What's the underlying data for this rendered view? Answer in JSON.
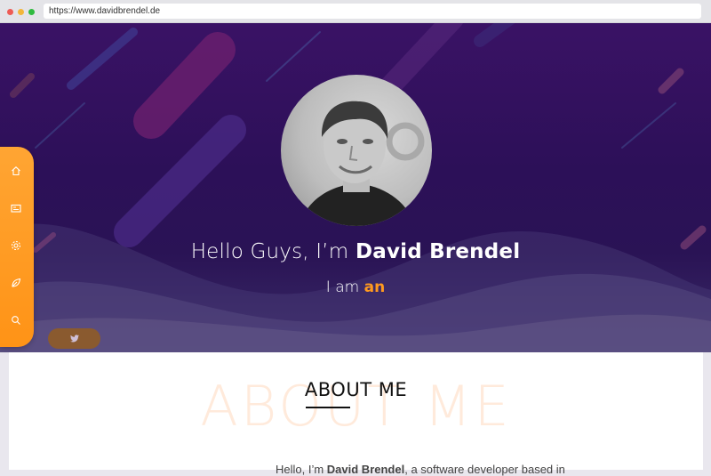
{
  "browser": {
    "url": "https://www.davidbrendel.de"
  },
  "hero": {
    "greeting_prefix": "Hello Guys, I’m ",
    "name": "David Brendel",
    "iam_prefix": "I am ",
    "typed_word": "an"
  },
  "sidebar": {
    "items": [
      {
        "icon": "home-icon"
      },
      {
        "icon": "portfolio-icon"
      },
      {
        "icon": "settings-icon"
      },
      {
        "icon": "leaf-icon"
      },
      {
        "icon": "search-icon"
      }
    ]
  },
  "social": {
    "twitter_icon": "twitter-icon"
  },
  "about": {
    "watermark": "ABOUT ME",
    "title": "ABOUT ME",
    "intro_prefix": "Hello, I’m ",
    "intro_name": "David Brendel",
    "intro_rest": ", a software developer based in"
  },
  "colors": {
    "accent": "#ff9a1f",
    "hero_bg": "#2c1058"
  }
}
